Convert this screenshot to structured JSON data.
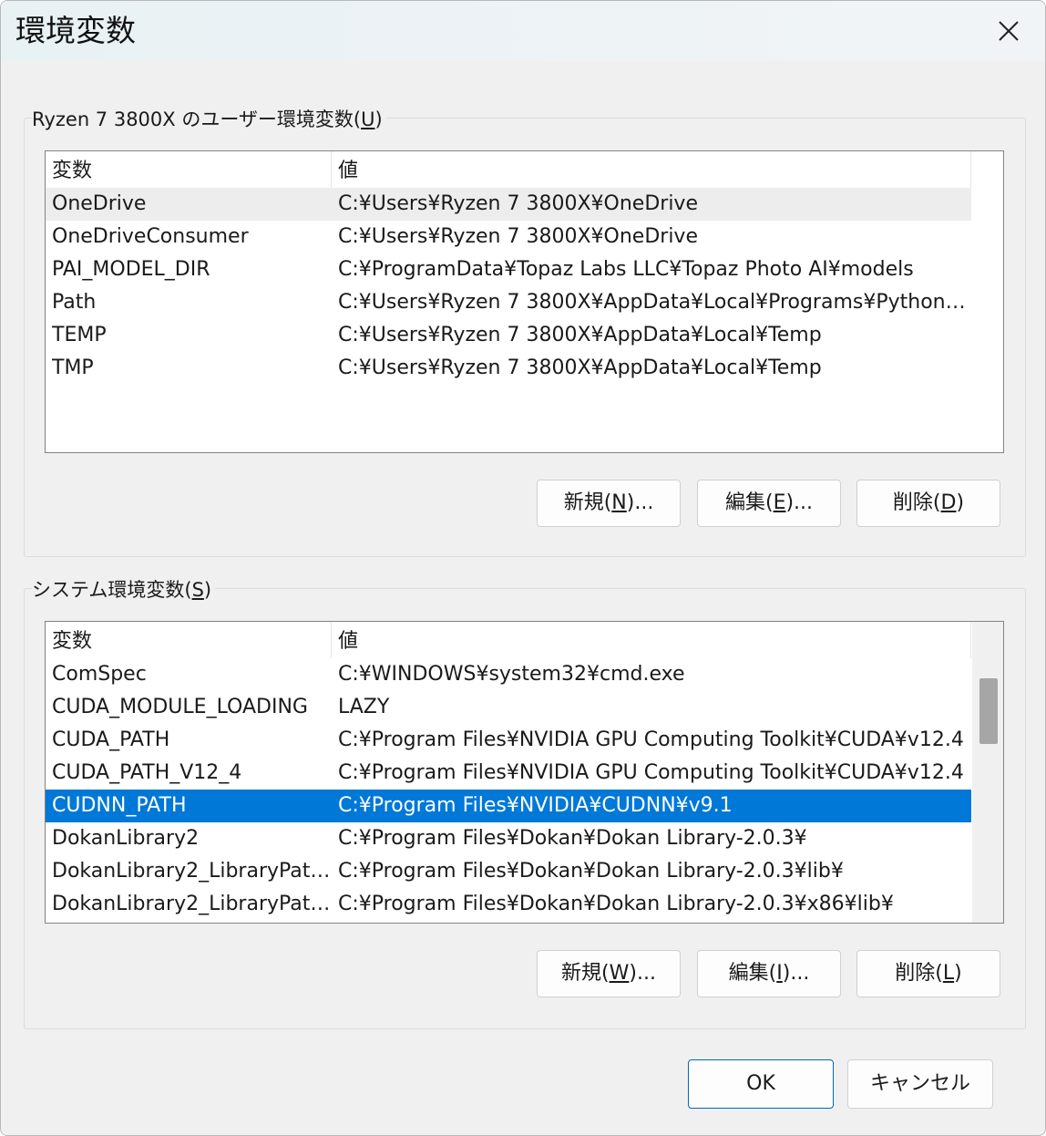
{
  "window": {
    "title": "環境変数"
  },
  "user_group": {
    "legend": "Ryzen 7 3800X のユーザー環境変数(",
    "legend_key": "U",
    "legend_end": ")",
    "columns": {
      "name": "変数",
      "value": "値"
    },
    "rows": [
      {
        "name": "OneDrive",
        "value": "C:¥Users¥Ryzen 7 3800X¥OneDrive"
      },
      {
        "name": "OneDriveConsumer",
        "value": "C:¥Users¥Ryzen 7 3800X¥OneDrive"
      },
      {
        "name": "PAI_MODEL_DIR",
        "value": "C:¥ProgramData¥Topaz Labs LLC¥Topaz Photo AI¥models"
      },
      {
        "name": "Path",
        "value": "C:¥Users¥Ryzen 7 3800X¥AppData¥Local¥Programs¥Python¥Py..."
      },
      {
        "name": "TEMP",
        "value": "C:¥Users¥Ryzen 7 3800X¥AppData¥Local¥Temp"
      },
      {
        "name": "TMP",
        "value": "C:¥Users¥Ryzen 7 3800X¥AppData¥Local¥Temp"
      }
    ],
    "buttons": {
      "new": {
        "label": "新規(",
        "key": "N",
        "end": ")..."
      },
      "edit": {
        "label": "編集(",
        "key": "E",
        "end": ")..."
      },
      "delete": {
        "label": "削除(",
        "key": "D",
        "end": ")"
      }
    }
  },
  "system_group": {
    "legend": "システム環境変数(",
    "legend_key": "S",
    "legend_end": ")",
    "columns": {
      "name": "変数",
      "value": "値"
    },
    "rows": [
      {
        "name": "ComSpec",
        "value": "C:¥WINDOWS¥system32¥cmd.exe"
      },
      {
        "name": "CUDA_MODULE_LOADING",
        "value": "LAZY"
      },
      {
        "name": "CUDA_PATH",
        "value": "C:¥Program Files¥NVIDIA GPU Computing Toolkit¥CUDA¥v12.4"
      },
      {
        "name": "CUDA_PATH_V12_4",
        "value": "C:¥Program Files¥NVIDIA GPU Computing Toolkit¥CUDA¥v12.4"
      },
      {
        "name": "CUDNN_PATH",
        "value": "C:¥Program Files¥NVIDIA¥CUDNN¥v9.1"
      },
      {
        "name": "DokanLibrary2",
        "value": "C:¥Program Files¥Dokan¥Dokan Library-2.0.3¥"
      },
      {
        "name": "DokanLibrary2_LibraryPath_...",
        "value": "C:¥Program Files¥Dokan¥Dokan Library-2.0.3¥lib¥"
      },
      {
        "name": "DokanLibrary2_LibraryPath_...",
        "value": "C:¥Program Files¥Dokan¥Dokan Library-2.0.3¥x86¥lib¥"
      }
    ],
    "selected_index": 4,
    "buttons": {
      "new": {
        "label": "新規(",
        "key": "W",
        "end": ")..."
      },
      "edit": {
        "label": "編集(",
        "key": "I",
        "end": ")..."
      },
      "delete": {
        "label": "削除(",
        "key": "L",
        "end": ")"
      }
    }
  },
  "footer": {
    "ok": "OK",
    "cancel": "キャンセル"
  }
}
